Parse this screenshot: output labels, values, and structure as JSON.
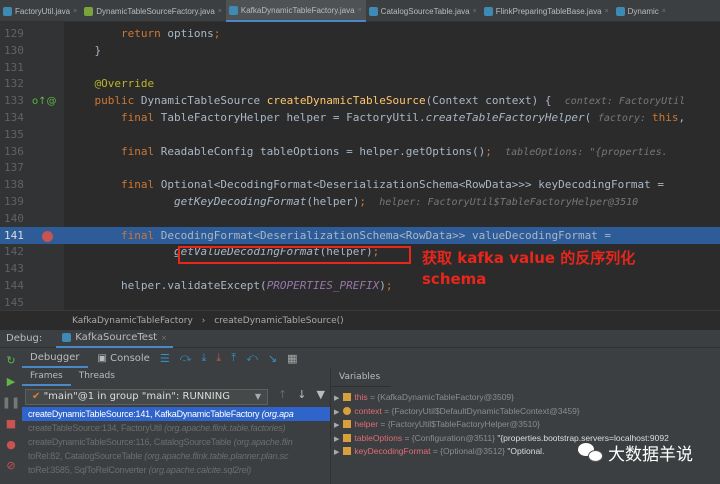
{
  "tabs": [
    {
      "label": "FactoryUtil.java",
      "icon": "class"
    },
    {
      "label": "DynamicTableSourceFactory.java",
      "icon": "interface"
    },
    {
      "label": "KafkaDynamicTableFactory.java",
      "icon": "class",
      "active": true
    },
    {
      "label": "CatalogSourceTable.java",
      "icon": "class"
    },
    {
      "label": "FlinkPreparingTableBase.java",
      "icon": "class"
    },
    {
      "label": "Dynamic",
      "icon": "class"
    }
  ],
  "code": [
    {
      "n": "129",
      "t": [
        [
          "k",
          "        return "
        ],
        [
          "",
          "options"
        ],
        [
          "k",
          ";"
        ]
      ]
    },
    {
      "n": "130",
      "t": [
        [
          "",
          "    }"
        ]
      ]
    },
    {
      "n": "131",
      "t": []
    },
    {
      "n": "132",
      "t": [
        [
          "a",
          "    @Override"
        ]
      ]
    },
    {
      "n": "133",
      "t": [
        [
          "k",
          "    public "
        ],
        [
          "",
          "DynamicTableSource "
        ],
        [
          "f",
          "createDynamicTableSource"
        ],
        [
          "",
          "(Context context) {  "
        ],
        [
          "hint",
          "context: FactoryUtil"
        ]
      ]
    },
    {
      "n": "134",
      "t": [
        [
          "k",
          "        final "
        ],
        [
          "",
          "TableFactoryHelper helper = FactoryUtil."
        ],
        [
          "it",
          "createTableFactoryHelper"
        ],
        [
          "",
          "( "
        ],
        [
          "hint",
          "factory: "
        ],
        [
          "k",
          "this"
        ],
        [
          "",
          ","
        ]
      ]
    },
    {
      "n": "135",
      "t": []
    },
    {
      "n": "136",
      "t": [
        [
          "k",
          "        final "
        ],
        [
          "",
          "ReadableConfig tableOptions = helper.getOptions()"
        ],
        [
          "k",
          ";  "
        ],
        [
          "hint",
          "tableOptions: \"{properties."
        ]
      ]
    },
    {
      "n": "137",
      "t": []
    },
    {
      "n": "138",
      "t": [
        [
          "k",
          "        final "
        ],
        [
          "",
          "Optional<DecodingFormat<DeserializationSchema<RowData>>> keyDecodingFormat =  "
        ]
      ]
    },
    {
      "n": "139",
      "t": [
        [
          "it",
          "                getKeyDecodingFormat"
        ],
        [
          "",
          "(helper)"
        ],
        [
          "k",
          ";  "
        ],
        [
          "hint",
          "helper: FactoryUtil$TableFactoryHelper@3510"
        ]
      ]
    },
    {
      "n": "140",
      "t": []
    },
    {
      "n": "141",
      "hl": true,
      "t": [
        [
          "k",
          "        final "
        ],
        [
          "",
          "DecodingFormat<DeserializationSchema<RowData>> valueDecodingFormat ="
        ]
      ]
    },
    {
      "n": "142",
      "t": [
        [
          "it",
          "                getValueDecodingFormat"
        ],
        [
          "",
          "(helper)"
        ],
        [
          "k",
          ";"
        ]
      ]
    },
    {
      "n": "143",
      "t": []
    },
    {
      "n": "144",
      "t": [
        [
          "",
          "        helper.validateExcept("
        ],
        [
          "cst",
          "PROPERTIES_PREFIX"
        ],
        [
          "",
          ")"
        ],
        [
          "k",
          ";"
        ]
      ]
    },
    {
      "n": "145",
      "t": []
    }
  ],
  "annotation": {
    "line1": "获取 kafka value 的反序列化",
    "line2": "schema",
    "color": "#e8261c"
  },
  "breadcrumb": {
    "class": "KafkaDynamicTableFactory",
    "sep": "›",
    "method": "createDynamicTableSource()"
  },
  "debug": {
    "label": "Debug:",
    "session": "KafkaSourceTest",
    "tabs": {
      "debugger": "Debugger",
      "console": "Console"
    },
    "frame_tabs": {
      "frames": "Frames",
      "threads": "Threads"
    },
    "thread": "\"main\"@1 in group \"main\": RUNNING",
    "frames": [
      {
        "m": "createDynamicTableSource:141, KafkaDynamicTableFactory ",
        "p": "(org.apa",
        "sel": true
      },
      {
        "m": "createTableSource:134, FactoryUtil ",
        "p": "(org.apache.flink.table.factories)"
      },
      {
        "m": "createDynamicTableSource:116, CatalogSourceTable ",
        "p": "(org.apache.flin"
      },
      {
        "m": "toRel:82, CatalogSourceTable ",
        "p": "(org.apache.flink.table.planner.plan.sc"
      },
      {
        "m": "toRel:3585, SqlToRelConverter ",
        "p": "(org.apache.calcite.sql2rel)"
      }
    ],
    "variables_label": "Variables",
    "variables": [
      {
        "name": "this",
        "val": " = {KafkaDynamicTableFactory@3509}",
        "str": "",
        "icon": "field"
      },
      {
        "name": "context",
        "val": " = {FactoryUtil$DefaultDynamicTableContext@3459}",
        "str": "",
        "icon": "param"
      },
      {
        "name": "helper",
        "val": " = {FactoryUtil$TableFactoryHelper@3510}",
        "str": "",
        "icon": "field"
      },
      {
        "name": "tableOptions",
        "val": " = {Configuration@3511} ",
        "str": "\"{properties.bootstrap.servers=localhost:9092",
        "icon": "field"
      },
      {
        "name": "keyDecodingFormat",
        "val": " = {Optional@3512} ",
        "str": "\"Optional.",
        "icon": "field"
      }
    ]
  },
  "watermark": "大数据羊说"
}
